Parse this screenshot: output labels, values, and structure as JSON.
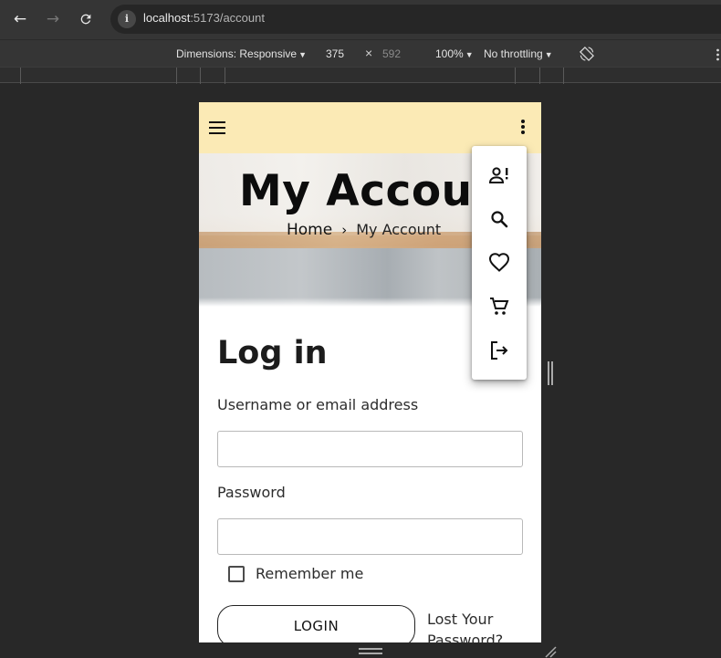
{
  "browser": {
    "url_host": "localhost",
    "url_path": ":5173/account",
    "icons": [
      "back-arrow-icon",
      "forward-arrow-icon",
      "reload-icon",
      "site-info-icon"
    ]
  },
  "device_toolbar": {
    "dimensions_label": "Dimensions: Responsive",
    "width": "375",
    "times": "×",
    "height": "592",
    "zoom": "100%",
    "throttling": "No throttling"
  },
  "app": {
    "hero_title": "My Accoun",
    "breadcrumb": {
      "home": "Home",
      "separator": "›",
      "current": "My Account"
    },
    "login": {
      "title": "Log in",
      "username_label": "Username or email address",
      "username_value": "",
      "password_label": "Password",
      "password_value": "",
      "remember_label": "Remember me",
      "remember_checked": false,
      "login_button": "LOGIN",
      "lost_password": "Lost Your Password?"
    },
    "colors": {
      "header_bg": "#fbeab5",
      "menu_bg": "#ffffff"
    },
    "menu_items": [
      {
        "icon": "account-alert-icon"
      },
      {
        "icon": "search-icon"
      },
      {
        "icon": "heart-icon"
      },
      {
        "icon": "cart-icon"
      },
      {
        "icon": "logout-icon"
      }
    ]
  }
}
